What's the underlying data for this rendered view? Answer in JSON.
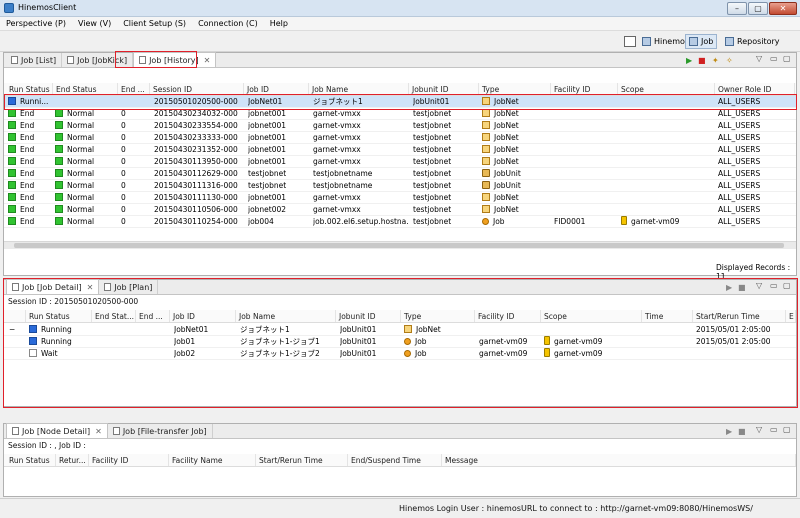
{
  "window": {
    "title": "HinemosClient",
    "buttons": [
      "–",
      "▢",
      "✕"
    ]
  },
  "menu": [
    "Perspective (P)",
    "View (V)",
    "Client Setup (S)",
    "Connection (C)",
    "Help"
  ],
  "perspectives": [
    {
      "label": "Hinemos",
      "active": false
    },
    {
      "label": "Job",
      "active": true
    },
    {
      "label": "Repository",
      "active": false
    }
  ],
  "top_tabs": [
    {
      "label": "Job [List]",
      "active": false
    },
    {
      "label": "Job [JobKick]",
      "active": false
    },
    {
      "label": "Job [History]",
      "active": true
    }
  ],
  "history": {
    "columns": [
      "Run Status",
      "End Status",
      "End ...",
      "Session ID",
      "Job ID",
      "Job Name",
      "Jobunit ID",
      "Type",
      "Facility ID",
      "Scope",
      "Owner Role ID"
    ],
    "rows": [
      {
        "run": "Runni...",
        "run_icon": "blue",
        "end": "",
        "end_icon": "",
        "endval": "",
        "session": "20150501020500-000",
        "jobid": "JobNet01",
        "jobname": "ジョブネット1",
        "unit": "JobUnit01",
        "type": "JobNet",
        "type_icon": "jobnet",
        "facility": "",
        "scope": "",
        "owner": "ALL_USERS",
        "selected": true
      },
      {
        "run": "End",
        "run_icon": "green",
        "end": "Normal",
        "end_icon": "green",
        "endval": "0",
        "session": "20150430234032-000",
        "jobid": "jobnet001",
        "jobname": "garnet-vmxx",
        "unit": "testjobnet",
        "type": "JobNet",
        "type_icon": "jobnet",
        "facility": "",
        "scope": "",
        "owner": "ALL_USERS"
      },
      {
        "run": "End",
        "run_icon": "green",
        "end": "Normal",
        "end_icon": "green",
        "endval": "0",
        "session": "20150430233554-000",
        "jobid": "jobnet001",
        "jobname": "garnet-vmxx",
        "unit": "testjobnet",
        "type": "JobNet",
        "type_icon": "jobnet",
        "facility": "",
        "scope": "",
        "owner": "ALL_USERS"
      },
      {
        "run": "End",
        "run_icon": "green",
        "end": "Normal",
        "end_icon": "green",
        "endval": "0",
        "session": "20150430233333-000",
        "jobid": "jobnet001",
        "jobname": "garnet-vmxx",
        "unit": "testjobnet",
        "type": "JobNet",
        "type_icon": "jobnet",
        "facility": "",
        "scope": "",
        "owner": "ALL_USERS"
      },
      {
        "run": "End",
        "run_icon": "green",
        "end": "Normal",
        "end_icon": "green",
        "endval": "0",
        "session": "20150430231352-000",
        "jobid": "jobnet001",
        "jobname": "garnet-vmxx",
        "unit": "testjobnet",
        "type": "JobNet",
        "type_icon": "jobnet",
        "facility": "",
        "scope": "",
        "owner": "ALL_USERS"
      },
      {
        "run": "End",
        "run_icon": "green",
        "end": "Normal",
        "end_icon": "green",
        "endval": "0",
        "session": "20150430113950-000",
        "jobid": "jobnet001",
        "jobname": "garnet-vmxx",
        "unit": "testjobnet",
        "type": "JobNet",
        "type_icon": "jobnet",
        "facility": "",
        "scope": "",
        "owner": "ALL_USERS"
      },
      {
        "run": "End",
        "run_icon": "green",
        "end": "Normal",
        "end_icon": "green",
        "endval": "0",
        "session": "20150430112629-000",
        "jobid": "testjobnet",
        "jobname": "testjobnetname",
        "unit": "testjobnet",
        "type": "JobUnit",
        "type_icon": "jobunit",
        "facility": "",
        "scope": "",
        "owner": "ALL_USERS"
      },
      {
        "run": "End",
        "run_icon": "green",
        "end": "Normal",
        "end_icon": "green",
        "endval": "0",
        "session": "20150430111316-000",
        "jobid": "testjobnet",
        "jobname": "testjobnetname",
        "unit": "testjobnet",
        "type": "JobUnit",
        "type_icon": "jobunit",
        "facility": "",
        "scope": "",
        "owner": "ALL_USERS"
      },
      {
        "run": "End",
        "run_icon": "green",
        "end": "Normal",
        "end_icon": "green",
        "endval": "0",
        "session": "20150430111130-000",
        "jobid": "jobnet001",
        "jobname": "garnet-vmxx",
        "unit": "testjobnet",
        "type": "JobNet",
        "type_icon": "jobnet",
        "facility": "",
        "scope": "",
        "owner": "ALL_USERS"
      },
      {
        "run": "End",
        "run_icon": "green",
        "end": "Normal",
        "end_icon": "green",
        "endval": "0",
        "session": "20150430110506-000",
        "jobid": "jobnet002",
        "jobname": "garnet-vmxx",
        "unit": "testjobnet",
        "type": "JobNet",
        "type_icon": "jobnet",
        "facility": "",
        "scope": "",
        "owner": "ALL_USERS"
      },
      {
        "run": "End",
        "run_icon": "green",
        "end": "Normal",
        "end_icon": "green",
        "endval": "0",
        "session": "20150430110254-000",
        "jobid": "job004",
        "jobname": "job.002.el6.setup.hostna...",
        "unit": "testjobnet",
        "type": "Job",
        "type_icon": "job",
        "facility": "FID0001",
        "scope": "garnet-vm09",
        "owner": "ALL_USERS"
      }
    ],
    "displayed_records": "Displayed Records : 11"
  },
  "detail_tabs": [
    {
      "label": "Job [Job Detail]",
      "active": true
    },
    {
      "label": "Job [Plan]",
      "active": false
    }
  ],
  "detail": {
    "session_line": "Session ID : 20150501020500-000",
    "columns": [
      "Run Status",
      "End Stat...",
      "End ...",
      "Job ID",
      "Job Name",
      "Jobunit ID",
      "Type",
      "Facility ID",
      "Scope",
      "Time",
      "Start/Rerun Time",
      "E"
    ],
    "rows": [
      {
        "expander": "−",
        "run": "Running",
        "run_icon": "blue",
        "jobid": "JobNet01",
        "jobname": "ジョブネット1",
        "unit": "JobUnit01",
        "type": "JobNet",
        "type_icon": "jobnet",
        "facility": "",
        "scope": "",
        "start": "2015/05/01 2:05:00"
      },
      {
        "expander": "",
        "run": "Running",
        "run_icon": "blue",
        "jobid": "Job01",
        "jobname": "ジョブネット1-ジョブ1",
        "unit": "JobUnit01",
        "type": "Job",
        "type_icon": "job",
        "facility": "garnet-vm09",
        "scope": "garnet-vm09",
        "start": "2015/05/01 2:05:00"
      },
      {
        "expander": "",
        "run": "Wait",
        "run_icon": "white",
        "jobid": "Job02",
        "jobname": "ジョブネット1-ジョブ2",
        "unit": "JobUnit01",
        "type": "Job",
        "type_icon": "job",
        "facility": "garnet-vm09",
        "scope": "garnet-vm09",
        "start": ""
      }
    ]
  },
  "node_tabs": [
    {
      "label": "Job [Node Detail]",
      "active": true
    },
    {
      "label": "Job [File-transfer Job]",
      "active": false
    }
  ],
  "node": {
    "session_line": "Session ID : ,  Job ID :",
    "columns": [
      "Run Status",
      "Retur...",
      "Facility ID",
      "Facility Name",
      "Start/Rerun Time",
      "End/Suspend Time",
      "Message"
    ]
  },
  "status": {
    "login": "Hinemos Login User : hinemos",
    "url": "URL to connect to : http://garnet-vm09:8080/HinemosWS/"
  }
}
